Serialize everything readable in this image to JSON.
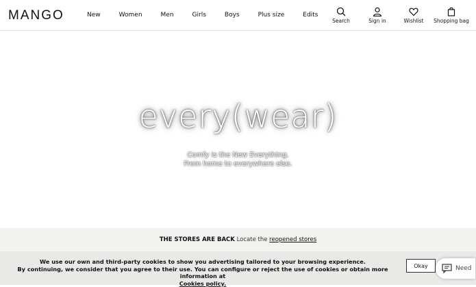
{
  "header": {
    "logo": "MANGO",
    "nav": [
      "New",
      "Women",
      "Men",
      "Girls",
      "Boys",
      "Plus size",
      "Edits"
    ],
    "tools": {
      "search": {
        "label": "Search",
        "icon": "search-icon"
      },
      "signin": {
        "label": "Sign in",
        "icon": "user-icon"
      },
      "wishlist": {
        "label": "Wishlist",
        "icon": "heart-icon"
      },
      "bag": {
        "label": "Shopping bag",
        "icon": "bag-icon"
      }
    }
  },
  "hero": {
    "title": "every(wear)",
    "subtitle_line1": "Comfy is the New Everything.",
    "subtitle_line2": "From home to everywhere else."
  },
  "stores": {
    "bold": "THE STORES ARE BACK",
    "text": "Locate the",
    "link": "reopened stores"
  },
  "cookie": {
    "line1": "We use our own and third-party cookies to show you advertising tailored to your browsing experience.",
    "line2": "By continuing, we consider that you agree to their use. You can configure or reject the use of cookies or obtain more information at",
    "link": "Cookies policy.",
    "ok": "Okay"
  },
  "help": {
    "label": "Need",
    "icon": "chat-icon"
  }
}
